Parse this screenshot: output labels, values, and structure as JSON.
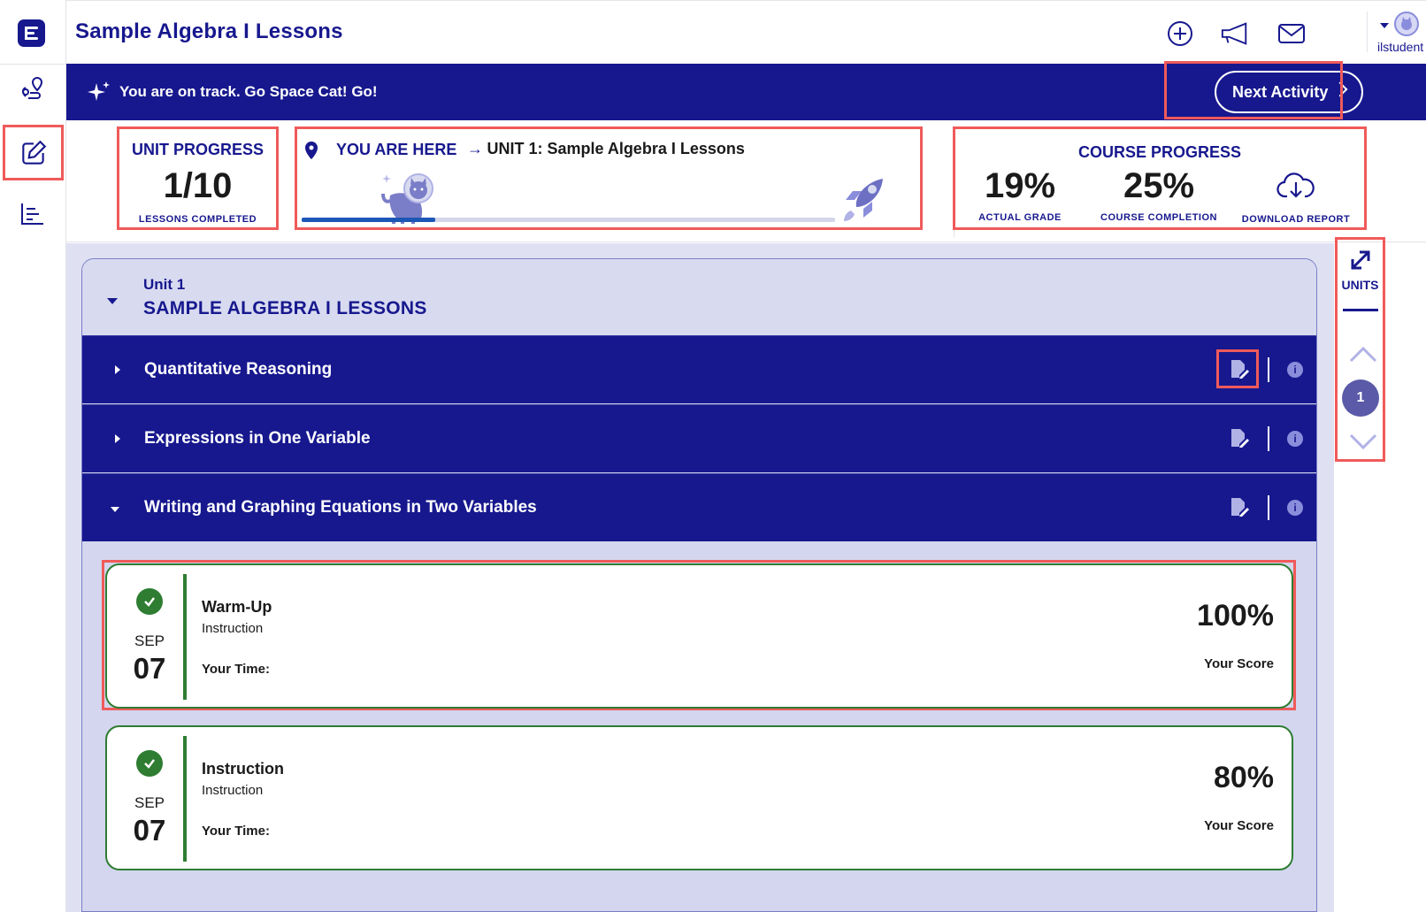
{
  "header": {
    "title": "Sample Algebra I Lessons",
    "username": "ilstudent",
    "icons": [
      "plus-circle-icon",
      "megaphone-icon",
      "mail-icon"
    ]
  },
  "sidebar": {
    "items": [
      {
        "name": "logo-icon"
      },
      {
        "name": "route-map-icon"
      },
      {
        "name": "edit-icon",
        "active": true
      },
      {
        "name": "chart-icon"
      }
    ]
  },
  "banner": {
    "message": "You are on track. Go Space Cat! Go!",
    "next_label": "Next Activity"
  },
  "unit_progress": {
    "title": "UNIT PROGRESS",
    "value": "1/10",
    "sub": "LESSONS COMPLETED"
  },
  "you_are_here": {
    "label": "YOU ARE HERE",
    "arrow": "→",
    "unit": "UNIT 1: Sample Algebra I Lessons",
    "progress": 0.25
  },
  "course_progress": {
    "title": "COURSE PROGRESS",
    "actual_grade": "19%",
    "actual_grade_label": "ACTUAL GRADE",
    "completion": "25%",
    "completion_label": "COURSE COMPLETION",
    "download_label": "DOWNLOAD REPORT"
  },
  "unit": {
    "small": "Unit 1",
    "title": "SAMPLE ALGEBRA I LESSONS",
    "lessons": [
      {
        "title": "Quantitative Reasoning",
        "expanded": false
      },
      {
        "title": "Expressions in One Variable",
        "expanded": false
      },
      {
        "title": "Writing and Graphing Equations in Two Variables",
        "expanded": true
      }
    ],
    "activities": [
      {
        "month": "SEP",
        "day": "07",
        "title": "Warm-Up",
        "type": "Instruction",
        "time_label": "Your Time:",
        "score": "100%",
        "score_label": "Your Score"
      },
      {
        "month": "SEP",
        "day": "07",
        "title": "Instruction",
        "type": "Instruction",
        "time_label": "Your Time:",
        "score": "80%",
        "score_label": "Your Score"
      }
    ]
  },
  "rail": {
    "label": "UNITS",
    "current": "1"
  },
  "colors": {
    "navy": "#17188e",
    "highlight": "#f05a5a",
    "complete_green": "#2e7d32",
    "panel": "#d3d6ee"
  }
}
